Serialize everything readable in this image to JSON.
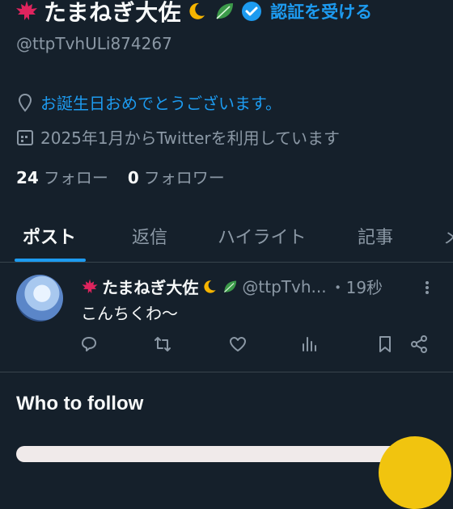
{
  "profile": {
    "display_name": "たまねぎ大佐",
    "verify_label": "認証を受ける",
    "handle": "@ttpTvhULi874267",
    "birthday_text": "お誕生日おめでとうございます。",
    "joined_text": "2025年1月からTwitterを利用しています",
    "following_count": "24",
    "following_label": "フォロー",
    "followers_count": "0",
    "followers_label": "フォロワー"
  },
  "tabs": [
    {
      "label": "ポスト"
    },
    {
      "label": "返信"
    },
    {
      "label": "ハイライト"
    },
    {
      "label": "記事"
    },
    {
      "label": "メ"
    }
  ],
  "post": {
    "author_name": "たまねぎ大佐",
    "author_handle": "@ttpTvh...",
    "time": "・19秒",
    "text": "こんちくわ〜"
  },
  "who_to_follow": "Who to follow",
  "colors": {
    "background": "#15202b",
    "accent": "#1d9bf0",
    "muted": "#8b98a5",
    "text": "#f7f9f9"
  },
  "icons": {
    "maple_leaf": "maple-leaf-icon",
    "moon": "crescent-moon-icon",
    "leaf": "leaf-icon",
    "verified": "verified-badge-icon",
    "location": "location-pin-icon",
    "calendar": "calendar-icon"
  }
}
